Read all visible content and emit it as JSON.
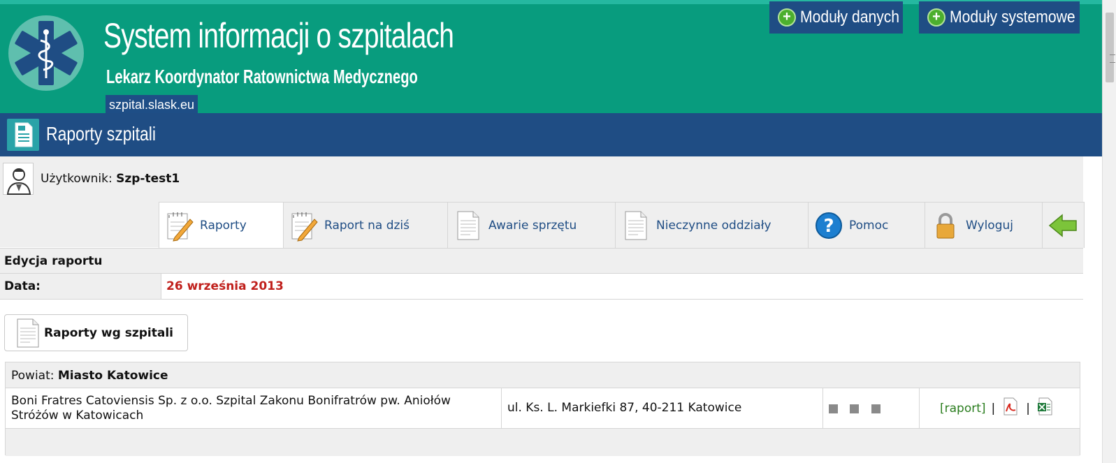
{
  "header": {
    "title": "System informacji o szpitalach",
    "subtitle": "Lekarz Koordynator Ratownictwa Medycznego",
    "domain": "szpital.slask.eu",
    "buttons": [
      "Moduły danych",
      "Moduły systemowe"
    ],
    "accent_color": "#089c7e",
    "nav_color": "#1f4d84"
  },
  "page": {
    "title": "Raporty szpitali"
  },
  "user": {
    "label": "Użytkownik:",
    "name": "Szp-test1"
  },
  "tabs": [
    {
      "label": "Raporty",
      "icon": "notepad-pencil-icon"
    },
    {
      "label": "Raport na dziś",
      "icon": "notepad-pencil-icon"
    },
    {
      "label": "Awarie sprzętu",
      "icon": "document-icon"
    },
    {
      "label": "Nieczynne oddziały",
      "icon": "document-icon"
    },
    {
      "label": "Pomoc",
      "icon": "help-icon"
    },
    {
      "label": "Wyloguj",
      "icon": "lock-icon"
    },
    {
      "label": "",
      "icon": "back-arrow-icon"
    }
  ],
  "form": {
    "edit_label": "Edycja raportu",
    "date_label": "Data:",
    "date_value": "26 września 2013"
  },
  "report_button": "Raporty wg szpitali",
  "table": {
    "powiat_label": "Powiat:",
    "powiat_name": "Miasto Katowice",
    "rows": [
      {
        "name": "Boni Fratres Catoviensis Sp. z o.o. Szpital Zakonu Bonifratrów pw. Aniołów Stróżów w Katowicach",
        "address": "ul. Ks. L. Markiefki 87, 40-211 Katowice",
        "link": "[raport]",
        "separator": "|"
      }
    ]
  }
}
